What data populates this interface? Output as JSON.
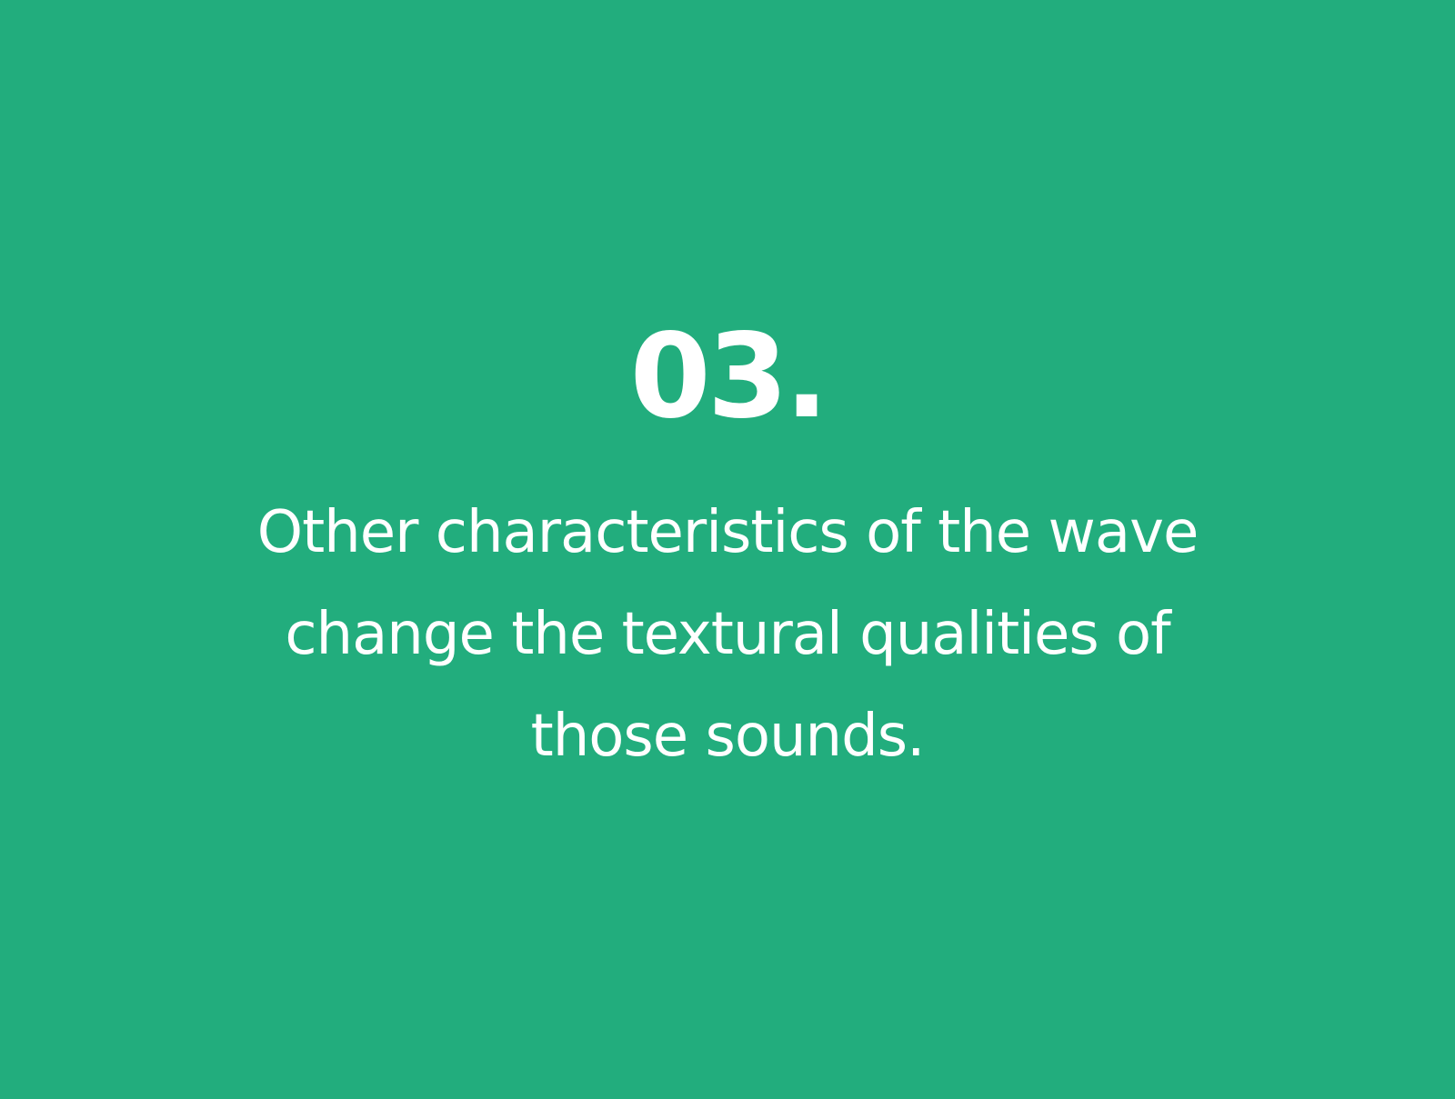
{
  "slide": {
    "background_color": "#22ad7d",
    "text_color": "#ffffff",
    "number": "03.",
    "body_lines": [
      "Other characteristics of the wave",
      "change the textural qualities of",
      "those sounds."
    ]
  }
}
